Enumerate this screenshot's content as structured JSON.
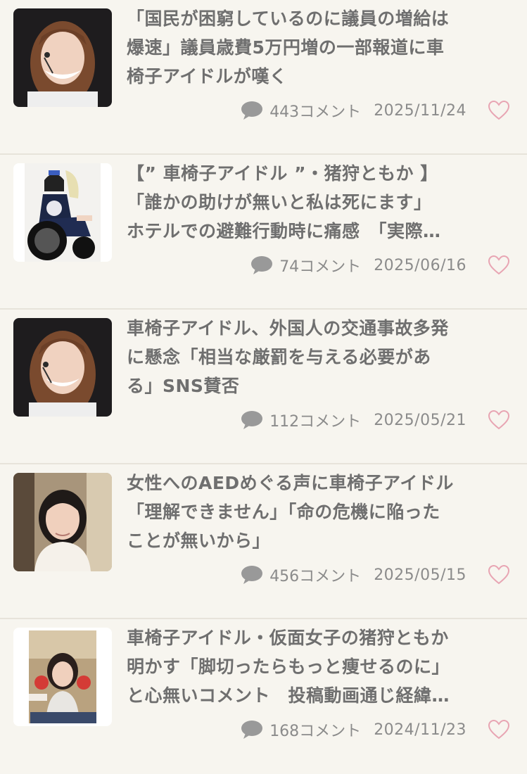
{
  "accent_heart_color": "#e8a5b3",
  "articles": [
    {
      "title_lines": [
        "「国民が困窮しているのに議員の増給は",
        "爆速」議員歳費5万円増の一部報道に車",
        "椅子アイドルが嘆く"
      ],
      "comments": "443コメント",
      "date": "2025/11/24",
      "thumbnail": "woman-with-headset-photo"
    },
    {
      "title_lines": [
        "【” 車椅子アイドル ”・猪狩ともか 】",
        "「誰かの助けが無いと私は死にます」",
        "ホテルでの避難行動時に痛感　「実際…"
      ],
      "comments": "74コメント",
      "date": "2025/06/16",
      "thumbnail": "idol-in-wheelchair-photo"
    },
    {
      "title_lines": [
        "車椅子アイドル、外国人の交通事故多発",
        "に懸念「相当な厳罰を与える必要があ",
        "る」SNS賛否"
      ],
      "comments": "112コメント",
      "date": "2025/05/21",
      "thumbnail": "woman-with-headset-photo"
    },
    {
      "title_lines": [
        "女性へのAEDめぐる声に車椅子アイドル",
        "「理解できません」「命の危機に陥った",
        "ことが無いから」"
      ],
      "comments": "456コメント",
      "date": "2025/05/15",
      "thumbnail": "woman-white-top-photo"
    },
    {
      "title_lines": [
        "車椅子アイドル・仮面女子の猪狩ともか",
        "明かす「脚切ったらもっと痩せるのに」",
        "と心無いコメント　投稿動画通じ経緯…"
      ],
      "comments": "168コメント",
      "date": "2024/11/23",
      "thumbnail": "video-screenshot-photo"
    }
  ]
}
